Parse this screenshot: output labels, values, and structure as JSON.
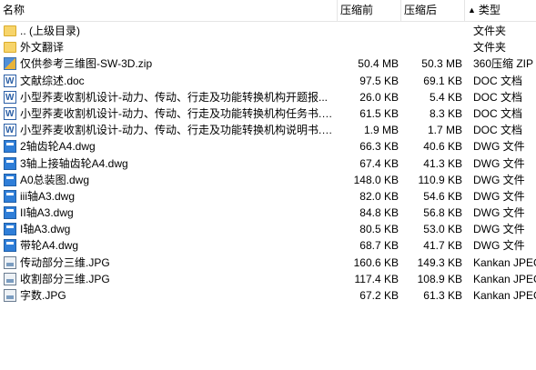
{
  "columns": {
    "name": "名称",
    "compressed": "压缩前",
    "original": "压缩后",
    "type_arrow": "▲",
    "type": "类型"
  },
  "files": [
    {
      "name": ".. (上级目录)",
      "csize": "",
      "osize": "",
      "type": "文件夹",
      "icon": "folder-icon"
    },
    {
      "name": "外文翻译",
      "csize": "",
      "osize": "",
      "type": "文件夹",
      "icon": "folder-icon"
    },
    {
      "name": "仅供参考三维图-SW-3D.zip",
      "csize": "50.4 MB",
      "osize": "50.3 MB",
      "type": "360压缩 ZIP",
      "icon": "zip-icon"
    },
    {
      "name": "文献综述.doc",
      "csize": "97.5 KB",
      "osize": "69.1 KB",
      "type": "DOC 文档",
      "icon": "doc-icon"
    },
    {
      "name": "小型荞麦收割机设计-动力、传动、行走及功能转换机构开题报...",
      "csize": "26.0 KB",
      "osize": "5.4 KB",
      "type": "DOC 文档",
      "icon": "doc-icon"
    },
    {
      "name": "小型荞麦收割机设计-动力、传动、行走及功能转换机构任务书.d...",
      "csize": "61.5 KB",
      "osize": "8.3 KB",
      "type": "DOC 文档",
      "icon": "doc-icon"
    },
    {
      "name": "小型荞麦收割机设计-动力、传动、行走及功能转换机构说明书.d...",
      "csize": "1.9 MB",
      "osize": "1.7 MB",
      "type": "DOC 文档",
      "icon": "doc-icon"
    },
    {
      "name": "2轴齿轮A4.dwg",
      "csize": "66.3 KB",
      "osize": "40.6 KB",
      "type": "DWG 文件",
      "icon": "dwg-icon"
    },
    {
      "name": "3轴上接轴齿轮A4.dwg",
      "csize": "67.4 KB",
      "osize": "41.3 KB",
      "type": "DWG 文件",
      "icon": "dwg-icon"
    },
    {
      "name": "A0总装图.dwg",
      "csize": "148.0 KB",
      "osize": "110.9 KB",
      "type": "DWG 文件",
      "icon": "dwg-icon"
    },
    {
      "name": "iii轴A3.dwg",
      "csize": "82.0 KB",
      "osize": "54.6 KB",
      "type": "DWG 文件",
      "icon": "dwg-icon"
    },
    {
      "name": "II轴A3.dwg",
      "csize": "84.8 KB",
      "osize": "56.8 KB",
      "type": "DWG 文件",
      "icon": "dwg-icon"
    },
    {
      "name": "I轴A3.dwg",
      "csize": "80.5 KB",
      "osize": "53.0 KB",
      "type": "DWG 文件",
      "icon": "dwg-icon"
    },
    {
      "name": "带轮A4.dwg",
      "csize": "68.7 KB",
      "osize": "41.7 KB",
      "type": "DWG 文件",
      "icon": "dwg-icon"
    },
    {
      "name": "传动部分三维.JPG",
      "csize": "160.6 KB",
      "osize": "149.3 KB",
      "type": "Kankan JPEG",
      "icon": "image-icon"
    },
    {
      "name": "收割部分三维.JPG",
      "csize": "117.4 KB",
      "osize": "108.9 KB",
      "type": "Kankan JPEG",
      "icon": "image-icon"
    },
    {
      "name": "字数.JPG",
      "csize": "67.2 KB",
      "osize": "61.3 KB",
      "type": "Kankan JPEG",
      "icon": "image-icon"
    }
  ]
}
